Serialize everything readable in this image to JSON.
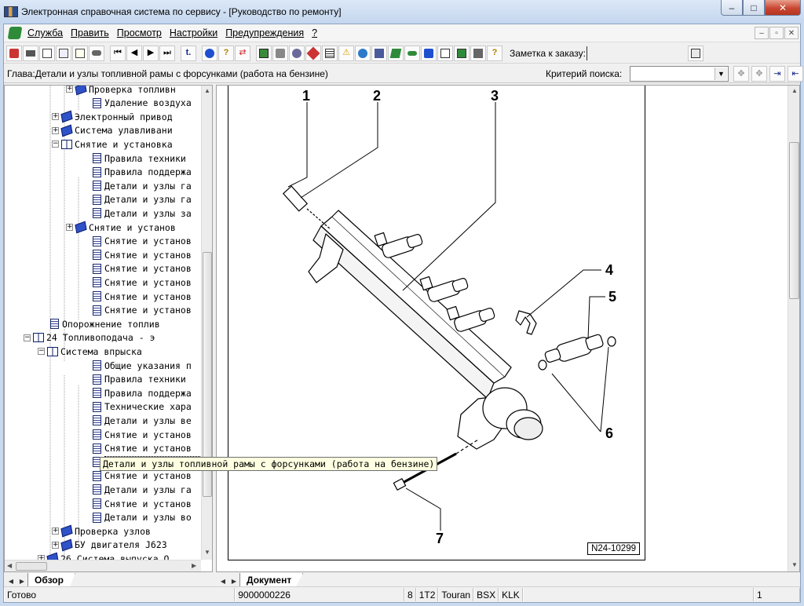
{
  "window": {
    "title": "Электронная справочная система по сервису - [Руководство по ремонту]",
    "buttons": [
      "–",
      "□",
      "✕"
    ]
  },
  "menu": {
    "items": [
      "Служба",
      "Править",
      "Просмотр",
      "Настройки",
      "Предупреждения",
      "?"
    ],
    "mdi_buttons": [
      "–",
      "▫",
      "✕"
    ]
  },
  "toolbar": {
    "order_label": "Заметка к заказу:"
  },
  "chapter": {
    "text": "Глава:Детали и узлы топливной рамы с форсунками (работа на бензине)",
    "criteria_label": "Критерий  поиска:",
    "criteria_value": ""
  },
  "tree": {
    "items": [
      {
        "label": "Проверка топливн",
        "icon": "book-icon",
        "expander": "+"
      },
      {
        "label": "Удаление воздуха",
        "icon": "document-icon",
        "expander": ""
      },
      {
        "label": "Электронный привод",
        "icon": "book-icon",
        "expander": "+"
      },
      {
        "label": "Система улавливани",
        "icon": "book-icon",
        "expander": "+"
      },
      {
        "label": "Снятие и установка",
        "icon": "open-book-icon",
        "expander": "−"
      },
      {
        "label": "Правила техники",
        "icon": "document-icon",
        "expander": ""
      },
      {
        "label": "Правила поддержа",
        "icon": "document-icon",
        "expander": ""
      },
      {
        "label": "Детали и узлы га",
        "icon": "document-icon",
        "expander": ""
      },
      {
        "label": "Детали и узлы га",
        "icon": "document-icon",
        "expander": ""
      },
      {
        "label": "Детали и узлы за",
        "icon": "document-icon",
        "expander": ""
      },
      {
        "label": "Снятие и установ",
        "icon": "book-icon",
        "expander": "+"
      },
      {
        "label": "Снятие и установ",
        "icon": "document-icon",
        "expander": ""
      },
      {
        "label": "Снятие и установ",
        "icon": "document-icon",
        "expander": ""
      },
      {
        "label": "Снятие и установ",
        "icon": "document-icon",
        "expander": ""
      },
      {
        "label": "Снятие и установ",
        "icon": "document-icon",
        "expander": ""
      },
      {
        "label": "Снятие и установ",
        "icon": "document-icon",
        "expander": ""
      },
      {
        "label": "Снятие и установ",
        "icon": "document-icon",
        "expander": ""
      },
      {
        "label": "Опорожнение топлив",
        "icon": "document-icon",
        "expander": ""
      },
      {
        "label": "24 Топливоподача - э",
        "icon": "open-book-icon",
        "expander": "−"
      },
      {
        "label": "Система впрыска",
        "icon": "open-book-icon",
        "expander": "−"
      },
      {
        "label": "Общие указания п",
        "icon": "document-icon",
        "expander": ""
      },
      {
        "label": "Правила техники",
        "icon": "document-icon",
        "expander": ""
      },
      {
        "label": "Правила поддержа",
        "icon": "document-icon",
        "expander": ""
      },
      {
        "label": "Технические хара",
        "icon": "document-icon",
        "expander": ""
      },
      {
        "label": "Детали и узлы ве",
        "icon": "document-icon",
        "expander": ""
      },
      {
        "label": "Снятие и установ",
        "icon": "document-icon",
        "expander": ""
      },
      {
        "label": "Снятие и установ",
        "icon": "document-icon",
        "expander": ""
      },
      {
        "label": "Детали и узлы топливной рамы с форсунками (работа на бензине)",
        "icon": "document-icon",
        "expander": "",
        "selected": true
      },
      {
        "label": "Снятие и установ",
        "icon": "document-icon",
        "expander": ""
      },
      {
        "label": "Детали и узлы га",
        "icon": "document-icon",
        "expander": ""
      },
      {
        "label": "Снятие и установ",
        "icon": "document-icon",
        "expander": ""
      },
      {
        "label": "Детали и узлы во",
        "icon": "document-icon",
        "expander": ""
      },
      {
        "label": "Проверка узлов",
        "icon": "book-icon",
        "expander": "+"
      },
      {
        "label": "БУ двигателя J623",
        "icon": "book-icon",
        "expander": "+"
      },
      {
        "label": "26 Система выпуска О",
        "icon": "book-icon",
        "expander": "+"
      }
    ],
    "tooltip": "Детали и узлы топливной рамы с форсунками (работа на бензине)"
  },
  "tabs": {
    "left": "Обзор",
    "right": "Документ"
  },
  "figure": {
    "callouts": [
      "1",
      "2",
      "3",
      "4",
      "5",
      "6",
      "7"
    ],
    "id": "N24-10299"
  },
  "status": {
    "text": "Готово",
    "number": "9000000226",
    "field1": "8",
    "field2": "1T2",
    "field3": "Touran",
    "field4": "BSX",
    "field5": "KLK",
    "page": "1"
  },
  "colors": {
    "accent_blue": "#2f52c8",
    "close_red": "#c94732",
    "tooltip_bg": "#ffffe1"
  }
}
